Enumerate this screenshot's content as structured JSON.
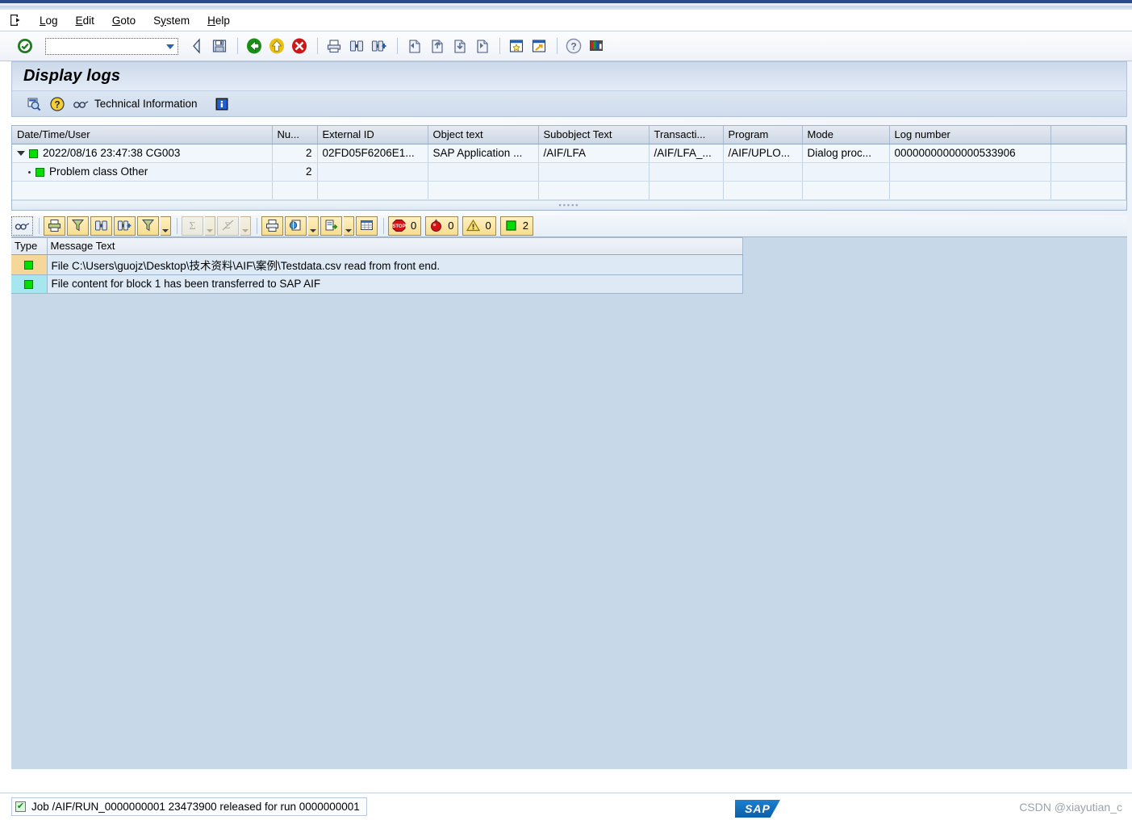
{
  "window": {
    "menu_icon": "exit-arrow-icon",
    "menu_items": [
      {
        "label": "Log",
        "accel": "L"
      },
      {
        "label": "Edit",
        "accel": "E"
      },
      {
        "label": "Goto",
        "accel": "G"
      },
      {
        "label": "System",
        "accel": "y"
      },
      {
        "label": "Help",
        "accel": "H"
      }
    ]
  },
  "toolbar": {
    "command_value": "",
    "command_placeholder": "",
    "buttons": [
      {
        "name": "enter-icon",
        "title": "Continue (Enter)"
      },
      {
        "name": "back-icon",
        "title": "Back"
      },
      {
        "name": "save-icon",
        "title": "Save"
      },
      {
        "name": "green-back-icon",
        "title": "Back"
      },
      {
        "name": "yellow-exit-icon",
        "title": "Exit"
      },
      {
        "name": "red-cancel-icon",
        "title": "Cancel"
      },
      {
        "name": "print-icon",
        "title": "Print"
      },
      {
        "name": "find-icon",
        "title": "Find"
      },
      {
        "name": "find-next-icon",
        "title": "Find Next"
      },
      {
        "name": "first-page-icon",
        "title": "First Page"
      },
      {
        "name": "previous-page-icon",
        "title": "Previous Page"
      },
      {
        "name": "next-page-icon",
        "title": "Next Page"
      },
      {
        "name": "last-page-icon",
        "title": "Last Page"
      },
      {
        "name": "create-session-icon",
        "title": "Create Session"
      },
      {
        "name": "create-shortcut-icon",
        "title": "Create Shortcut"
      },
      {
        "name": "help-icon",
        "title": "Help"
      },
      {
        "name": "customize-layout-icon",
        "title": "Customizing of Local Layout"
      }
    ]
  },
  "page": {
    "title": "Display logs",
    "app_toolbar": {
      "detail_icon": "detail-magnifier-icon",
      "help_icon": "question-mark-icon",
      "tech_icon": "technical-info-icon",
      "tech_label": "Technical Information",
      "info_icon": "info-icon"
    }
  },
  "log_grid": {
    "columns": [
      "Date/Time/User",
      "Nu...",
      "External ID",
      "Object text",
      "Subobject Text",
      "Transacti...",
      "Program",
      "Mode",
      "Log number",
      ""
    ],
    "rows": [
      {
        "expander": "expanded",
        "status_icon": "green-square-icon",
        "date_time_user": "2022/08/16  23:47:38  CG003",
        "number": "2",
        "external_id": "02FD05F6206E1...",
        "object_text": "SAP Application ...",
        "subobject_text": "/AIF/LFA",
        "transaction": "/AIF/LFA_...",
        "program": "/AIF/UPLO...",
        "mode": "Dialog proc...",
        "log_number": "00000000000000533906"
      },
      {
        "expander": "leaf",
        "status_icon": "green-square-icon",
        "date_time_user": "Problem class Other",
        "number": "2",
        "external_id": "",
        "object_text": "",
        "subobject_text": "",
        "transaction": "",
        "program": "",
        "mode": "",
        "log_number": ""
      }
    ]
  },
  "message_toolbar": {
    "buttons": [
      {
        "name": "technical-info-icon",
        "enabled": true,
        "dropdown": false
      },
      {
        "name": "print-icon",
        "enabled": true,
        "dropdown": false
      },
      {
        "name": "filter-icon",
        "enabled": true,
        "dropdown": false
      },
      {
        "name": "find-icon",
        "enabled": true,
        "dropdown": false
      },
      {
        "name": "find-next-icon",
        "enabled": true,
        "dropdown": false
      },
      {
        "name": "set-filter-icon",
        "enabled": true,
        "dropdown": true
      },
      {
        "name": "total-sum-icon",
        "enabled": false,
        "dropdown": true
      },
      {
        "name": "subtotal-icon",
        "enabled": false,
        "dropdown": true
      },
      {
        "name": "print-preview-icon",
        "enabled": true,
        "dropdown": false
      },
      {
        "name": "view-select-icon",
        "enabled": true,
        "dropdown": true
      },
      {
        "name": "export-icon",
        "enabled": true,
        "dropdown": true
      },
      {
        "name": "spreadsheet-icon",
        "enabled": true,
        "dropdown": false
      }
    ],
    "badges": [
      {
        "name": "abort-badge",
        "icon": "stop-icon",
        "count": "0"
      },
      {
        "name": "error-badge",
        "icon": "red-ball-icon",
        "count": "0"
      },
      {
        "name": "warning-badge",
        "icon": "yellow-triangle-icon",
        "count": "0"
      },
      {
        "name": "success-badge",
        "icon": "green-square-icon",
        "count": "2"
      }
    ]
  },
  "message_grid": {
    "columns": [
      "Type",
      "Message Text"
    ],
    "rows": [
      {
        "type_icon": "green-square-icon",
        "type_cell_style": "selected",
        "text": "File C:\\Users\\guojz\\Desktop\\技术资料\\AIF\\案例\\Testdata.csv read from front end."
      },
      {
        "type_icon": "green-square-icon",
        "type_cell_style": "cyan",
        "text": "File content for block 1 has been transferred to SAP AIF"
      }
    ]
  },
  "status_bar": {
    "status_icon": "green-check-icon",
    "message": "Job /AIF/RUN_0000000001 23473900 released for run 0000000001",
    "brand": "SAP",
    "watermark": "CSDN @xiayutian_c"
  },
  "colors": {
    "title_band": "#ccd9ea",
    "accent_blue": "#2b4a8b",
    "success_green": "#00e000",
    "toolbar_yellow": "#f7dd90",
    "grid_row": "#f2f7fc",
    "message_bg": "#ddeaf6",
    "selected_tan": "#f6d79a",
    "cyan_cell": "#a6e6ee",
    "empty_area": "#c7d8e8"
  }
}
